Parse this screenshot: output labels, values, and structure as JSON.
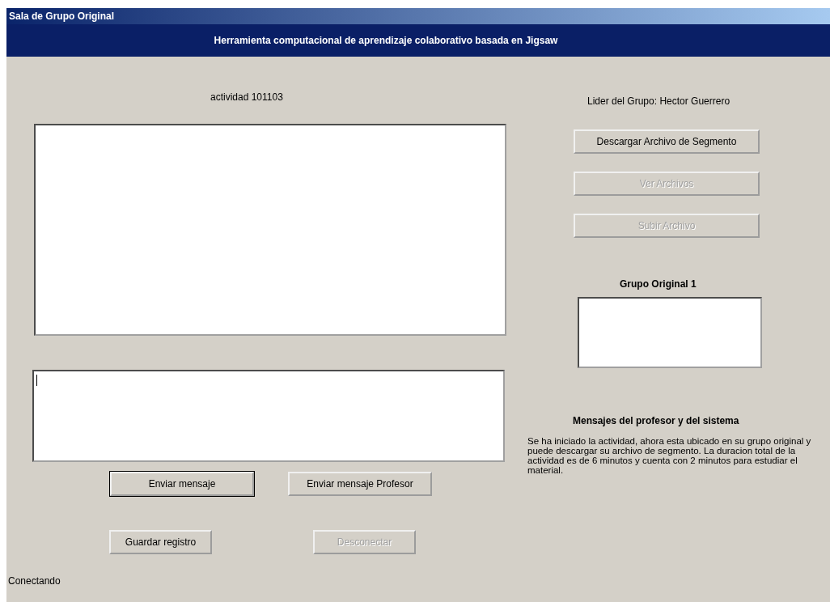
{
  "window": {
    "title": "Sala de Grupo Original"
  },
  "header": "Herramienta computacional de aprendizaje colaborativo basada en Jigsaw",
  "activity_label": "actividad 101103",
  "leader_label": "Lider del Grupo: Hector Guerrero",
  "chat": {
    "message_input": {
      "focused": true
    }
  },
  "chat_buttons": [
    {
      "label": "Enviar mensaje",
      "default": true,
      "disabled": false
    },
    {
      "label": "Enviar mensaje Profesor",
      "default": false,
      "disabled": false
    }
  ],
  "bottom_buttons": [
    {
      "label": "Guardar registro",
      "disabled": false
    },
    {
      "label": "Desconectar",
      "disabled": true
    }
  ],
  "file_buttons": [
    {
      "label": "Descargar Archivo de Segmento",
      "disabled": false
    },
    {
      "label": "Ver Archivos",
      "disabled": true
    },
    {
      "label": "Subir Archivo",
      "disabled": true
    }
  ],
  "group": {
    "title": "Grupo Original 1"
  },
  "messages": {
    "title": "Mensajes del profesor y del sistema",
    "text": "Se ha iniciado la actividad, ahora esta ubicado en su grupo original y puede descargar su archivo de segmento. La duracion total de la actividad es de 6 minutos y cuenta con 2 minutos para estudiar el material."
  },
  "status_bar": "Conectando"
}
